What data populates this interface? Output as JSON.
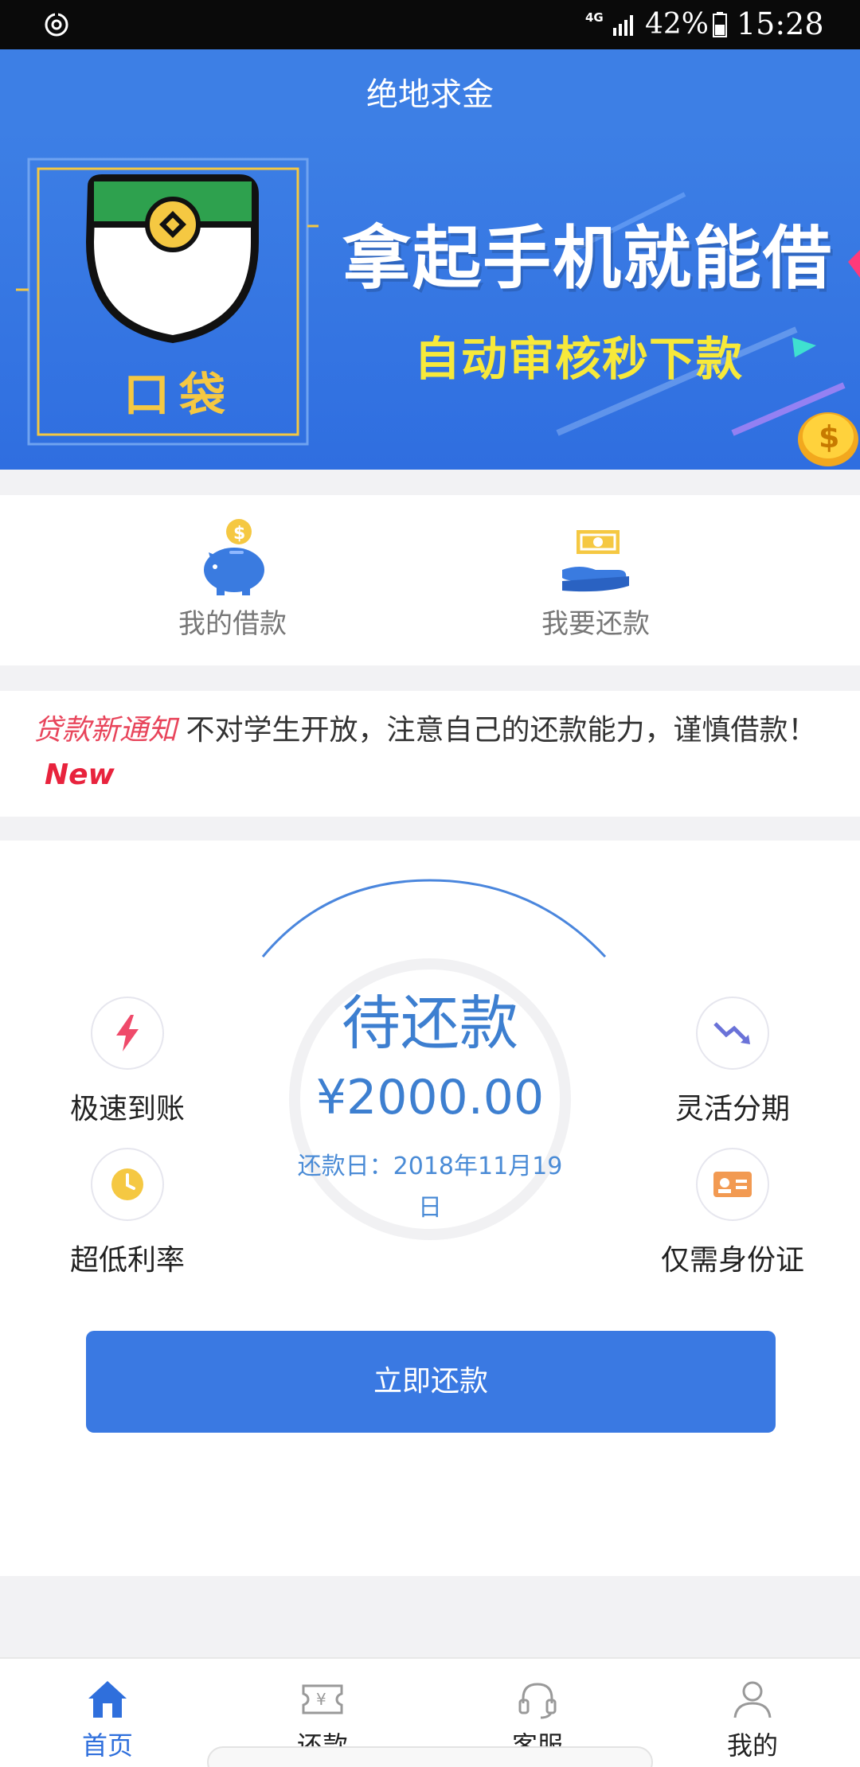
{
  "status_bar": {
    "network": "4G",
    "battery_percent": "42%",
    "time": "15:28"
  },
  "header": {
    "title": "绝地求金"
  },
  "banner": {
    "headline": "拿起手机就能借",
    "subline": "自动审核秒下款",
    "logo_text": "口袋"
  },
  "quick_actions": [
    {
      "label": "我的借款",
      "icon": "piggy-bank-icon"
    },
    {
      "label": "我要还款",
      "icon": "hand-money-icon"
    }
  ],
  "notice": {
    "tag": "贷款新通知",
    "text": "不对学生开放，注意自己的还款能力，谨慎借款！",
    "badge": "New"
  },
  "features": {
    "fast": "极速到账",
    "low_rate": "超低利率",
    "flexible": "灵活分期",
    "id_only": "仅需身份证"
  },
  "loan": {
    "status": "待还款",
    "amount": "¥2000.00",
    "due_date": "还款日：2018年11月19日"
  },
  "repay_button": "立即还款",
  "bottom_nav": [
    {
      "label": "首页",
      "icon": "home-icon",
      "active": true
    },
    {
      "label": "还款",
      "icon": "ticket-icon",
      "active": false
    },
    {
      "label": "客服",
      "icon": "headset-icon",
      "active": false
    },
    {
      "label": "我的",
      "icon": "user-icon",
      "active": false
    }
  ],
  "colors": {
    "primary": "#3d7fe5",
    "accent_red": "#e8233d",
    "banner_yellow": "#f7e93a"
  }
}
